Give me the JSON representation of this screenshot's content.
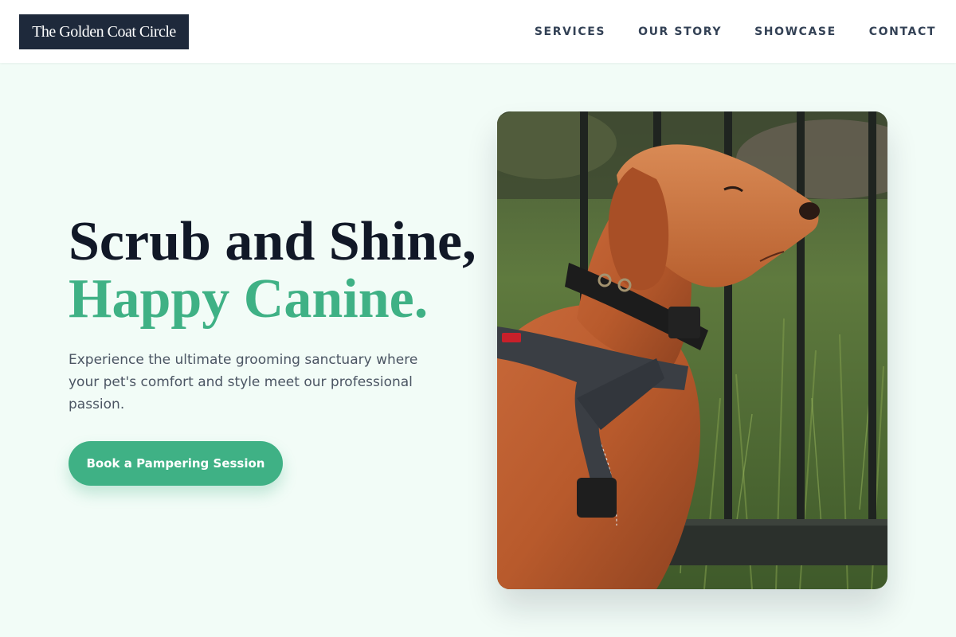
{
  "brand": {
    "name": "The Golden Coat Circle"
  },
  "nav": {
    "items": [
      {
        "label": "SERVICES"
      },
      {
        "label": "OUR STORY"
      },
      {
        "label": "SHOWCASE"
      },
      {
        "label": "CONTACT"
      }
    ]
  },
  "hero": {
    "headline_line1": "Scrub and Shine,",
    "headline_line2": "Happy Canine.",
    "description": "Experience the ultimate grooming sanctuary where your pet's comfort and style meet our professional passion.",
    "cta_label": "Book a Pampering Session",
    "image_subject": "dog-photo"
  },
  "colors": {
    "accent": "#3fb185",
    "brand_dark": "#1e293b",
    "heading": "#111827",
    "body_text": "#4b5563",
    "page_bg": "#f2fcf7"
  }
}
